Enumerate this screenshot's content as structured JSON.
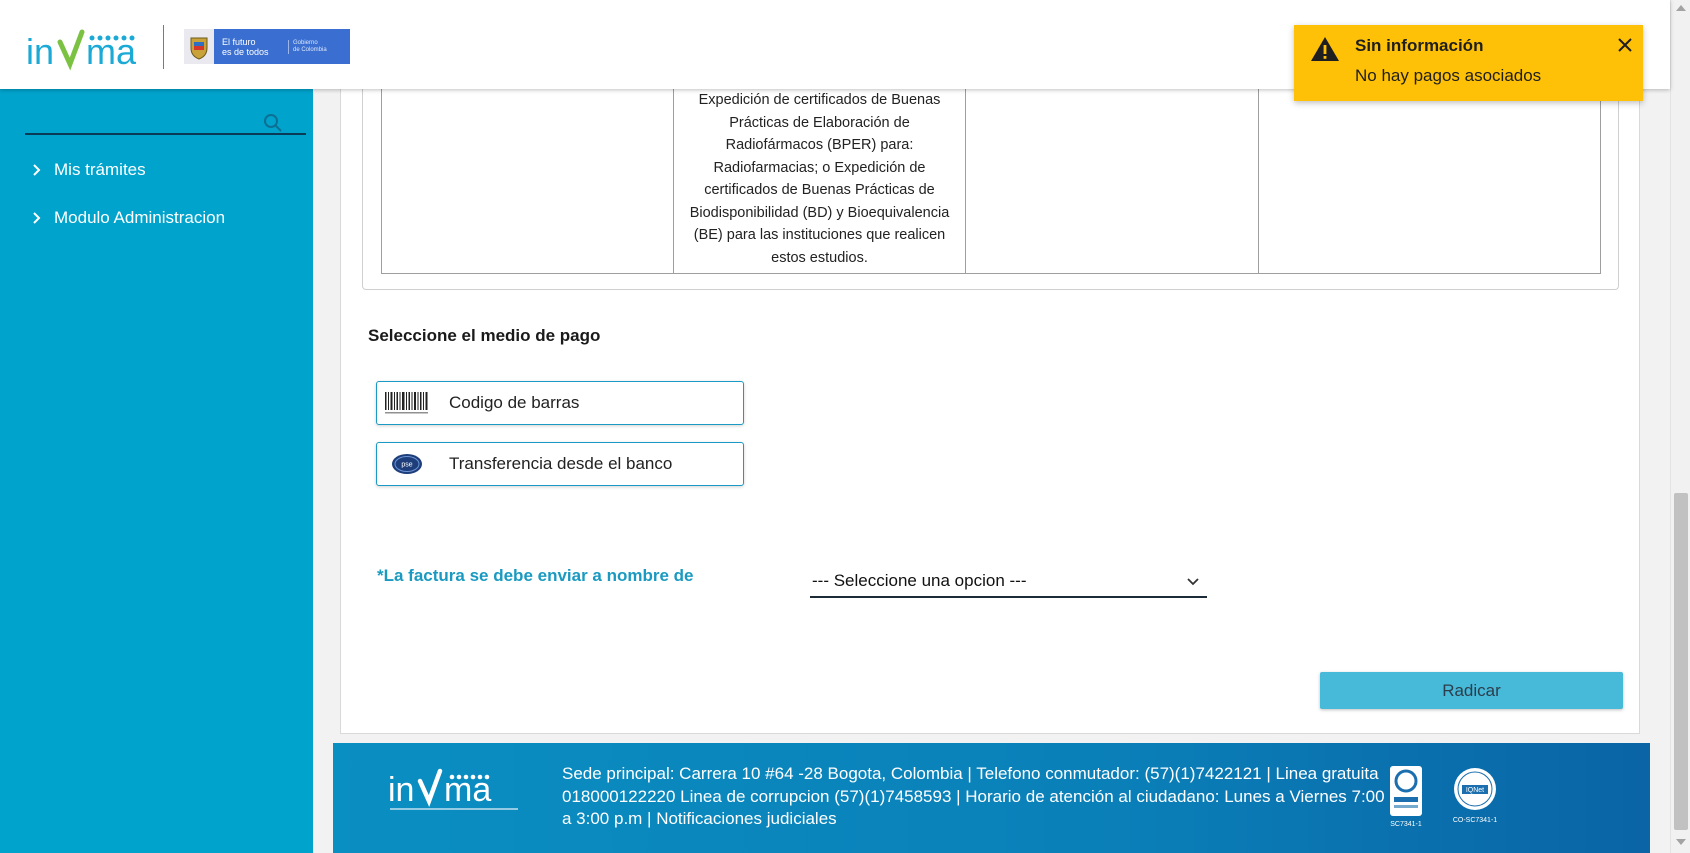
{
  "header": {
    "logo_text": "invima",
    "gov_logo_line1": "El futuro",
    "gov_logo_line2": "es de todos",
    "gov_logo_small1": "Gobierno",
    "gov_logo_small2": "de Colombia"
  },
  "sidebar": {
    "search": {
      "placeholder": ""
    },
    "items": [
      {
        "label": "Mis trámites"
      },
      {
        "label": "Modulo Administracion"
      }
    ]
  },
  "table": {
    "cell_text_lines": [
      "Expedición de certificados de Buenas",
      "Prácticas de Elaboración de",
      "Radiofármacos (BPER) para:",
      "Radiofarmacias; o Expedición de",
      "certificados de Buenas Prácticas de",
      "Biodisponibilidad (BD) y Bioequivalencia",
      "(BE) para las instituciones que realicen",
      "estos estudios."
    ]
  },
  "payment": {
    "title": "Seleccione el medio de pago",
    "options": [
      {
        "label": "Codigo de barras",
        "icon": "barcode-icon"
      },
      {
        "label": "Transferencia desde el banco",
        "icon": "pse-icon"
      }
    ]
  },
  "invoice": {
    "label": "*La factura se debe enviar a nombre de",
    "selected": "--- Seleccione una opcion ---"
  },
  "actions": {
    "submit_label": "Radicar"
  },
  "footer": {
    "text": "Sede principal: Carrera 10 #64 -28 Bogota, Colombia | Telefono conmutador: (57)(1)7422121 | Linea gratuita 018000122220 Linea de corrupcion (57)(1)7458593 | Horario de atención al ciudadano: Lunes a Viernes 7:00 a.m a 3:00 p.m | Notificaciones judiciales",
    "logo_text": "invima",
    "cert1_code": "SC7341-1",
    "cert2_code": "CO-SC7341-1"
  },
  "toast": {
    "title": "Sin información",
    "message": "No hay pagos asociados"
  },
  "colors": {
    "sidebar": "#00a3cc",
    "accent": "#1a9ac1",
    "warning": "#ffc107",
    "button": "#47b9d9",
    "footer": "#0a7fb8"
  }
}
